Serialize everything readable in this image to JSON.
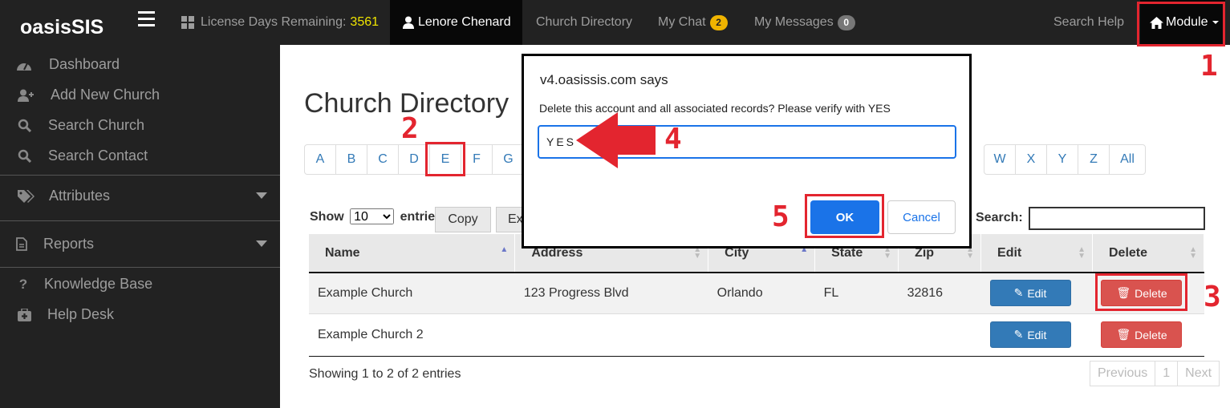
{
  "colors": {
    "annotation": "#e3252f",
    "topbar": "#222222",
    "primary": "#337ab7",
    "danger": "#d9534f",
    "dialog_accent": "#1a73e8"
  },
  "topbar": {
    "brand": "oasisSIS",
    "license_label": "License Days Remaining:",
    "license_days": "3561",
    "user": "Lenore Chenard",
    "church_directory": "Church Directory",
    "my_chat": "My Chat",
    "my_chat_count": "2",
    "my_messages": "My Messages",
    "my_messages_count": "0",
    "search_help": "Search Help",
    "module": "Module"
  },
  "sidebar": {
    "items": [
      {
        "label": "Dashboard",
        "icon": "dashboard-icon"
      },
      {
        "label": "Add New Church",
        "icon": "add-user-icon"
      },
      {
        "label": "Search Church",
        "icon": "search-icon"
      },
      {
        "label": "Search Contact",
        "icon": "search-icon"
      },
      {
        "label": "Attributes",
        "icon": "tags-icon"
      },
      {
        "label": "Reports",
        "icon": "file-icon"
      },
      {
        "label": "Knowledge Base",
        "icon": "question-icon"
      },
      {
        "label": "Help Desk",
        "icon": "medkit-icon"
      }
    ]
  },
  "main": {
    "title": "Church Directory",
    "letters_left": [
      "A",
      "B",
      "C",
      "D",
      "E",
      "F",
      "G"
    ],
    "letters_right": [
      "W",
      "X",
      "Y",
      "Z",
      "All"
    ],
    "show_label": "Show",
    "entries_value": "10",
    "entries_label": "entries",
    "copy_button": "Copy",
    "excel_button": "Ex",
    "search_label": "Search:",
    "table": {
      "headers": [
        "Name",
        "Address",
        "City",
        "State",
        "Zip",
        "Edit",
        "Delete"
      ],
      "rows": [
        {
          "name": "Example Church",
          "address": "123 Progress Blvd",
          "city": "Orlando",
          "state": "FL",
          "zip": "32816"
        },
        {
          "name": "Example Church 2",
          "address": "",
          "city": "",
          "state": "",
          "zip": ""
        }
      ],
      "edit_label": "Edit",
      "delete_label": "Delete"
    },
    "info": "Showing 1 to 2 of 2 entries",
    "pagination": {
      "previous": "Previous",
      "page": "1",
      "next": "Next"
    }
  },
  "dialog": {
    "title": "v4.oasissis.com says",
    "message": "Delete this account and all associated records?  Please verify with YES",
    "input_value": "YES",
    "ok": "OK",
    "cancel": "Cancel"
  },
  "annotations": [
    "1",
    "2",
    "3",
    "4",
    "5"
  ]
}
